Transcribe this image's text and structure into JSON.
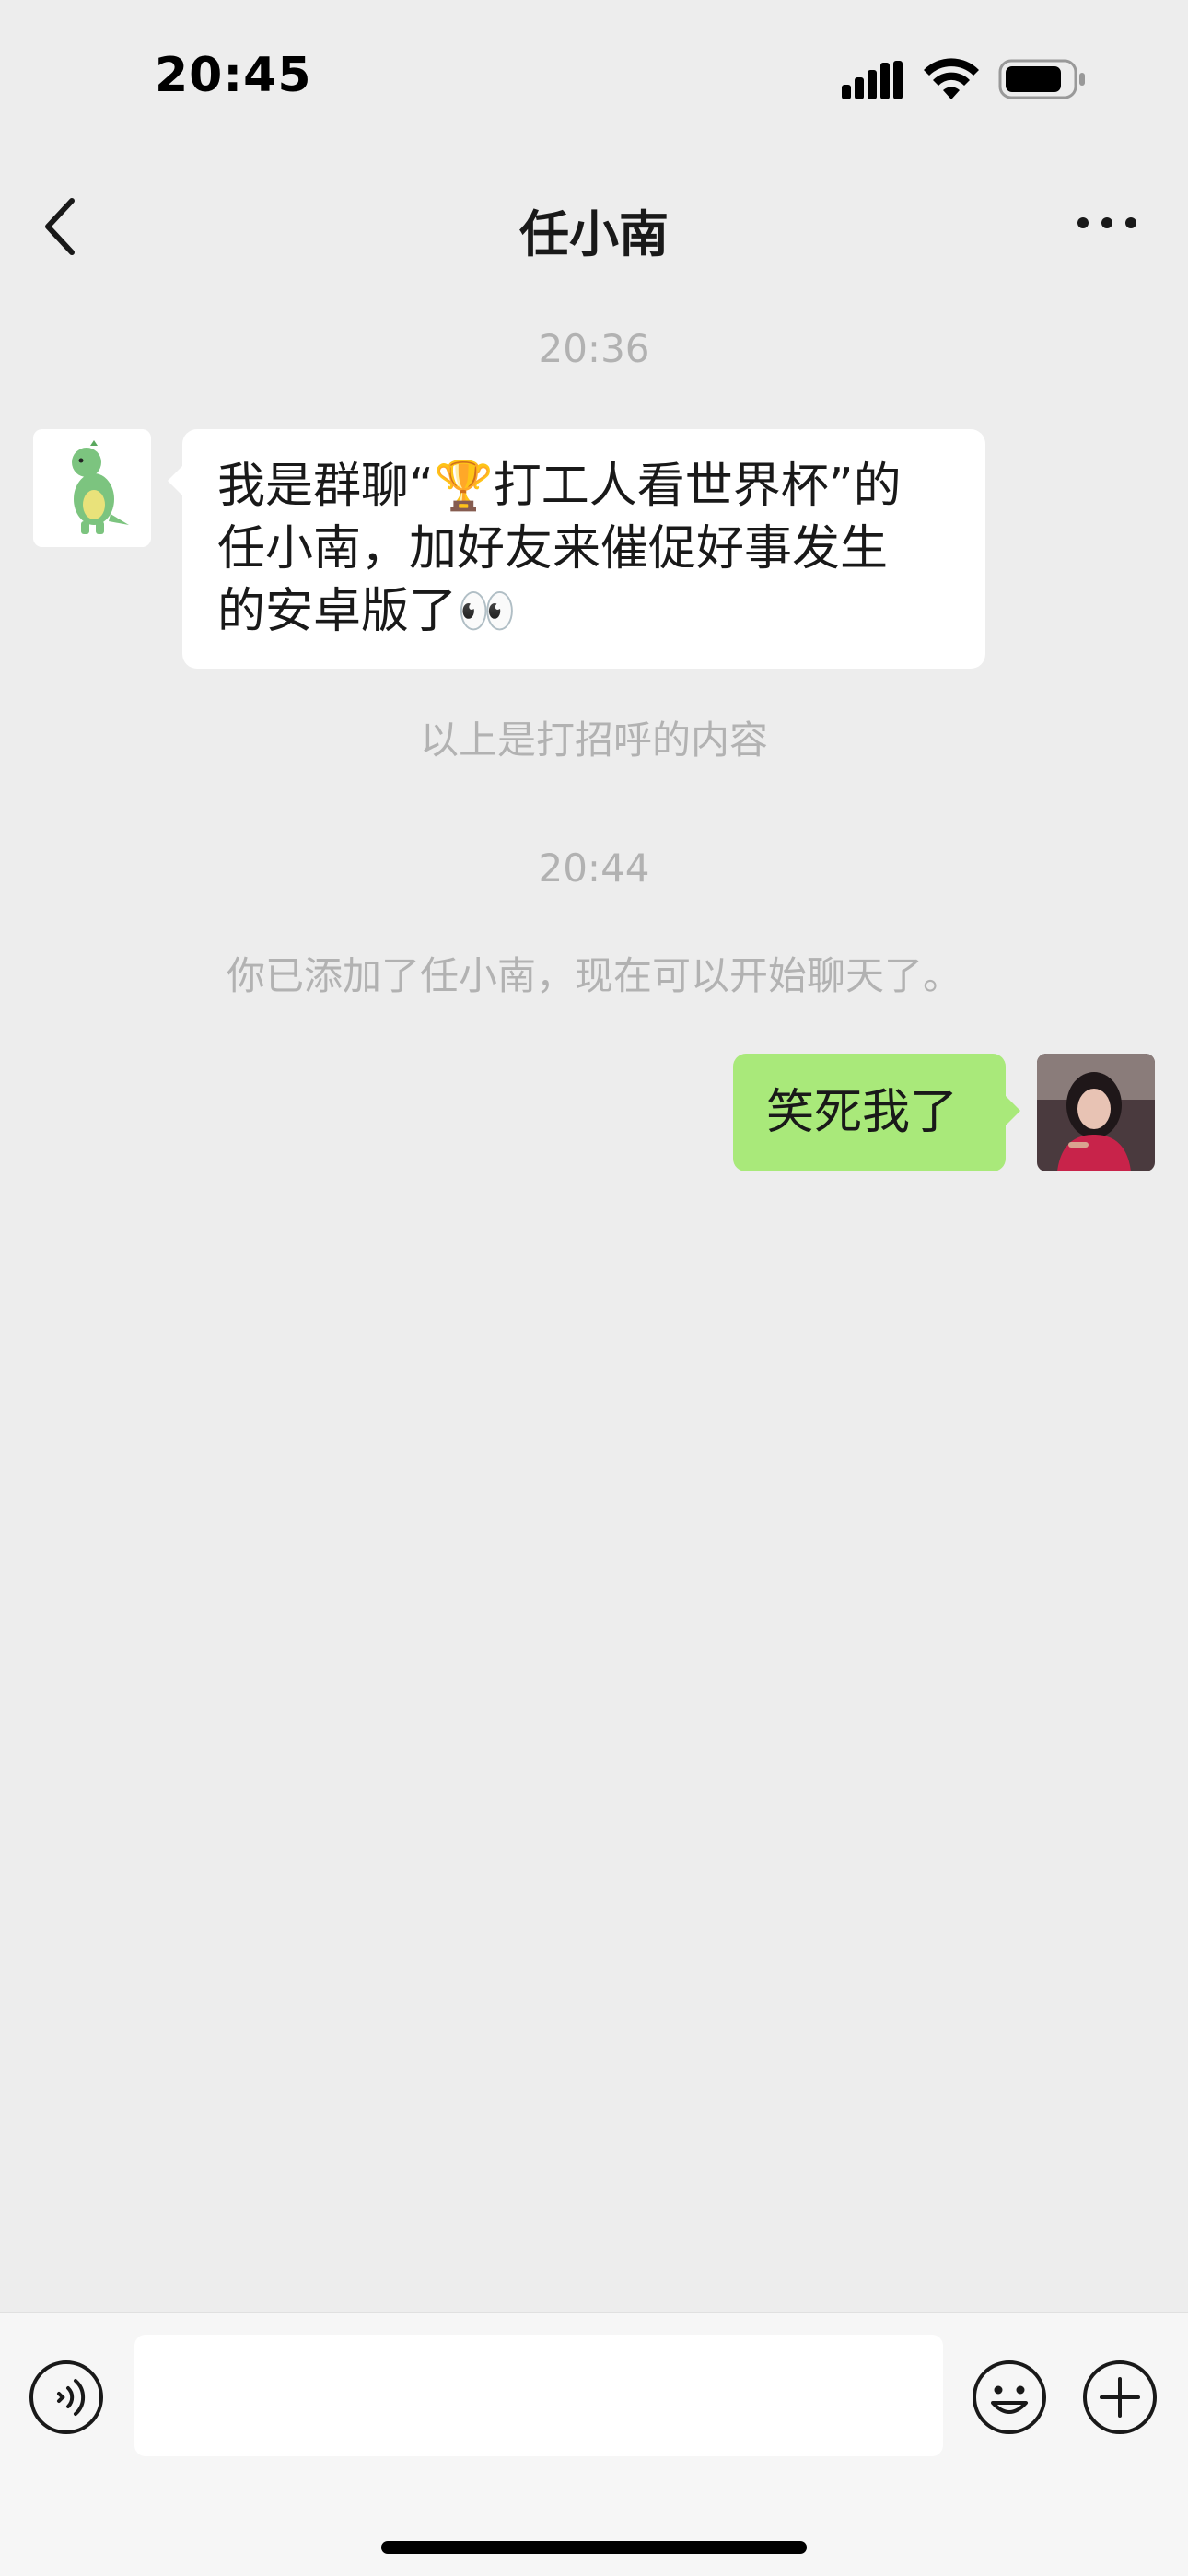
{
  "status_bar": {
    "time": "20:45"
  },
  "nav": {
    "title": "任小南"
  },
  "chat": {
    "timestamp_1": "20:36",
    "incoming_message": {
      "line_1_prefix": "我是群聊“",
      "line_1_suffix": "打工人看世界杯”的",
      "line_2": "任小南，加好友来催促好事发生",
      "line_3": "的安卓版了",
      "trophy_emoji": "🏆",
      "eyes_emoji": "👀"
    },
    "greeting_note": "以上是打招呼的内容",
    "timestamp_2": "20:44",
    "added_note": "你已添加了任小南，现在可以开始聊天了。",
    "outgoing_message": "笑死我了"
  },
  "input_bar": {
    "value": "",
    "placeholder": ""
  },
  "colors": {
    "background": "#EDEDED",
    "incoming_bubble": "#FFFFFF",
    "outgoing_bubble": "#A9E97A",
    "meta_text": "#B2B2B2"
  },
  "icons": [
    "back-icon",
    "more-icon",
    "voice-icon",
    "emoji-icon",
    "plus-icon",
    "dinosaur-avatar",
    "user-photo-avatar"
  ]
}
